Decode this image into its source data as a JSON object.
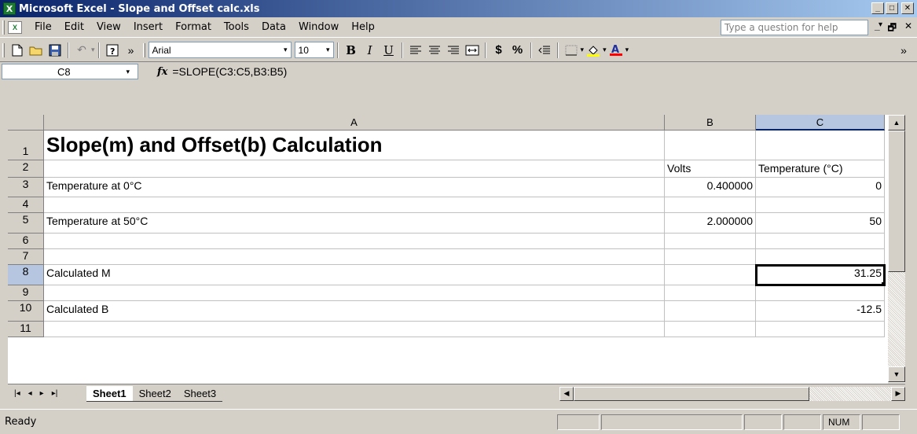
{
  "window": {
    "title": "Microsoft Excel - Slope and Offset calc.xls",
    "min": "_",
    "max": "□",
    "close": "✕",
    "app_icon": "X",
    "doc_icon": "X"
  },
  "menu": {
    "items": [
      "File",
      "Edit",
      "View",
      "Insert",
      "Format",
      "Tools",
      "Data",
      "Window",
      "Help"
    ],
    "help_placeholder": "Type a question for help",
    "help_arrow": "▾",
    "doc_min": "_",
    "doc_restore": "🗗",
    "doc_close": "✕"
  },
  "toolbar": {
    "font": "Arial",
    "font_size": "10",
    "bold": "B",
    "italic": "I",
    "underline": "U",
    "currency": "$",
    "percent": "%",
    "more": "»",
    "dropdown_arrow": "▾"
  },
  "formula_bar": {
    "name_box": "C8",
    "fx_label": "fx",
    "formula": "=SLOPE(C3:C5,B3:B5)"
  },
  "grid": {
    "columns": [
      {
        "label": "A",
        "selected": false
      },
      {
        "label": "B",
        "selected": false
      },
      {
        "label": "C",
        "selected": true
      }
    ],
    "rows": [
      {
        "num": "1",
        "a": "Slope(m) and Offset(b) Calculation",
        "b": "",
        "c": ""
      },
      {
        "num": "2",
        "a": "",
        "b": "Volts",
        "c": "Temperature (°C)"
      },
      {
        "num": "3",
        "a": "Temperature at 0°C",
        "b": "0.400000",
        "c": "0"
      },
      {
        "num": "4",
        "a": "",
        "b": "",
        "c": ""
      },
      {
        "num": "5",
        "a": "Temperature at 50°C",
        "b": "2.000000",
        "c": "50"
      },
      {
        "num": "6",
        "a": "",
        "b": "",
        "c": ""
      },
      {
        "num": "7",
        "a": "",
        "b": "",
        "c": ""
      },
      {
        "num": "8",
        "a": "Calculated M",
        "b": "",
        "c": "31.25"
      },
      {
        "num": "9",
        "a": "",
        "b": "",
        "c": ""
      },
      {
        "num": "10",
        "a": "Calculated B",
        "b": "",
        "c": "-12.5"
      },
      {
        "num": "11",
        "a": "",
        "b": "",
        "c": ""
      }
    ],
    "active_cell": "C8"
  },
  "sheets": {
    "tabs": [
      "Sheet1",
      "Sheet2",
      "Sheet3"
    ],
    "active": "Sheet1",
    "nav": [
      "|◂",
      "◂",
      "▸",
      "▸|"
    ]
  },
  "status": {
    "text": "Ready",
    "num": "NUM"
  }
}
